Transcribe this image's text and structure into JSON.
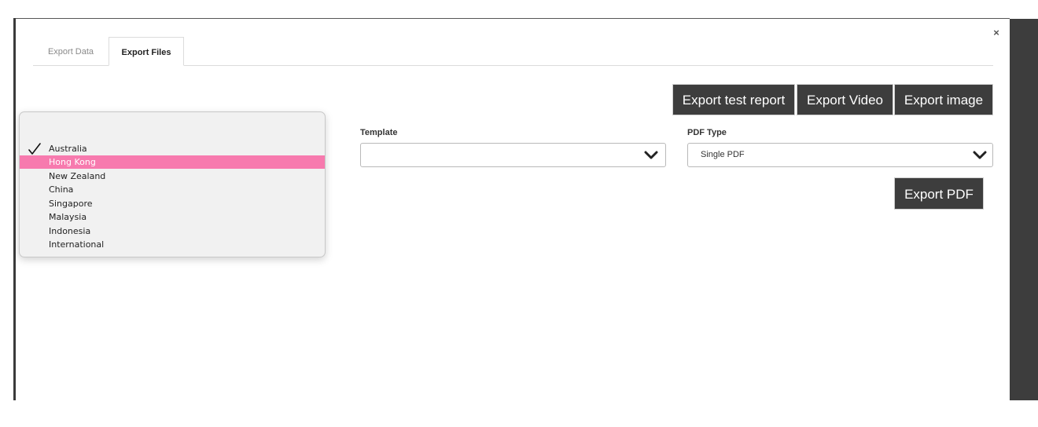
{
  "modal": {
    "close_label": "×",
    "tabs": [
      {
        "label": "Export Data",
        "active": false
      },
      {
        "label": "Export Files",
        "active": true
      }
    ]
  },
  "buttons": {
    "export_test_report": "Export test report",
    "export_video": "Export Video",
    "export_image": "Export image",
    "export_pdf": "Export PDF"
  },
  "fields": {
    "template": {
      "label": "Template",
      "value": ""
    },
    "pdf_type": {
      "label": "PDF Type",
      "value": "Single PDF"
    }
  },
  "region_dropdown": {
    "selected": "Australia",
    "highlighted": "Hong Kong",
    "options": [
      "Australia",
      "Hong Kong",
      "New Zealand",
      "China",
      "Singapore",
      "Malaysia",
      "Indonesia",
      "International"
    ]
  },
  "colors": {
    "button_bg": "#3d3d3d",
    "highlight": "#f77aae",
    "dropdown_bg": "#f1f1f1"
  },
  "icons": {
    "close": "close-icon",
    "chevron": "chevron-down-icon",
    "check": "checkmark-icon"
  }
}
